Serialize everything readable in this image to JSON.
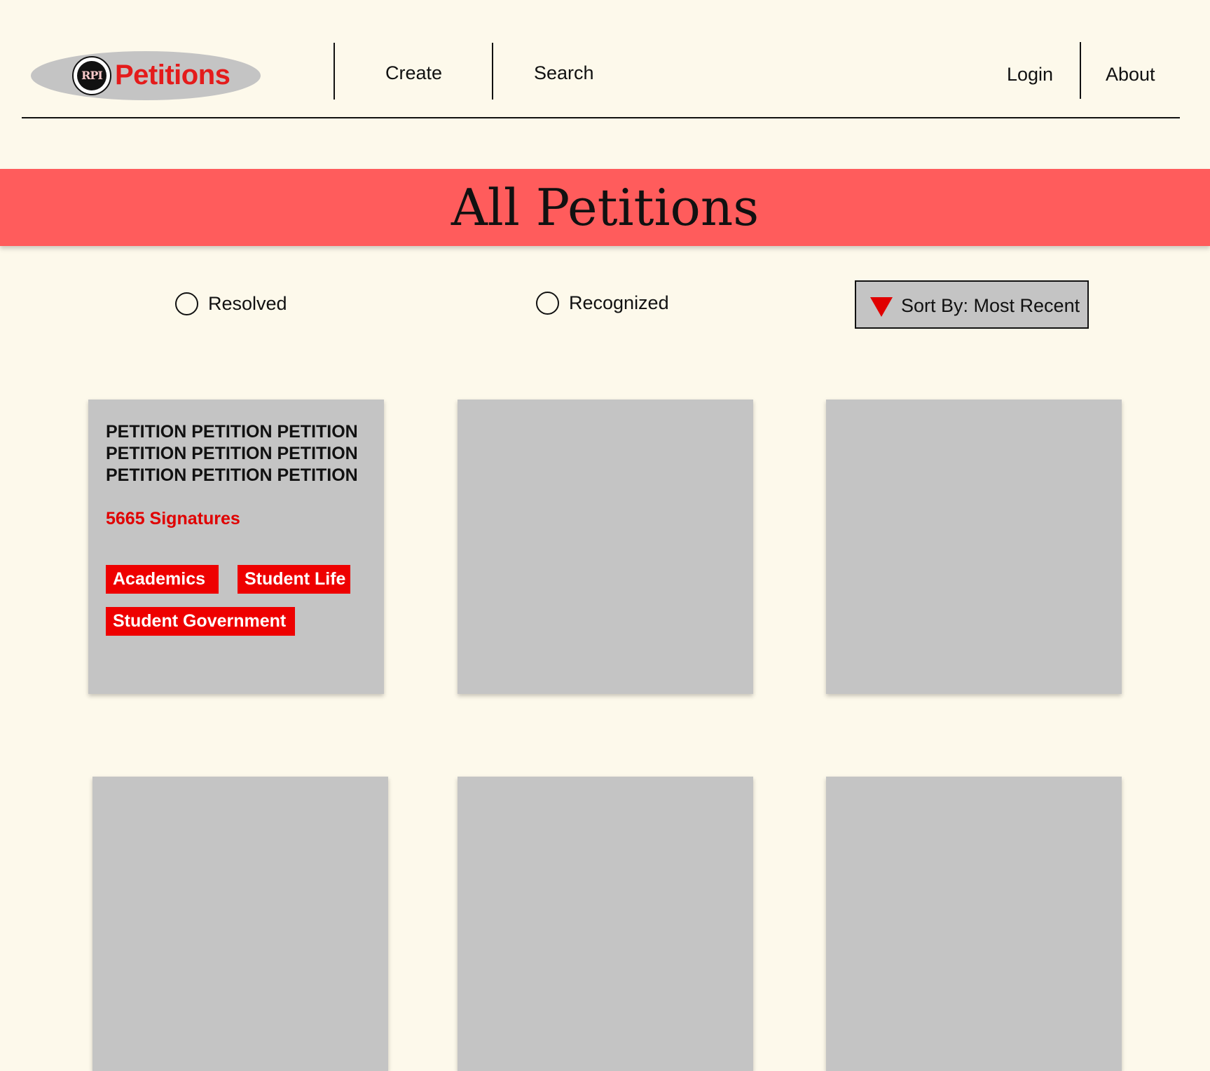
{
  "header": {
    "logo": {
      "seal_text": "RPI",
      "wordmark": "Petitions"
    },
    "nav": {
      "create": "Create",
      "search": "Search",
      "login": "Login",
      "about": "About"
    }
  },
  "banner": {
    "title": "All Petitions"
  },
  "filters": {
    "resolved_label": "Resolved",
    "resolved_checked": false,
    "recognized_label": "Recognized",
    "recognized_checked": false,
    "sort_label": "Sort By: Most Recent"
  },
  "petitions": [
    {
      "title": "PETITION PETITION PETITION PETITION PETITION PETITION PETITION PETITION PETITION",
      "signatures": "5665 Signatures",
      "tags": [
        "Academics",
        "Student Life",
        "Student Government"
      ]
    }
  ],
  "colors": {
    "background": "#fdf9eb",
    "banner": "#ff5c5c",
    "accent": "#e41b1b",
    "tag": "#ee0000",
    "card": "#c4c4c4"
  }
}
